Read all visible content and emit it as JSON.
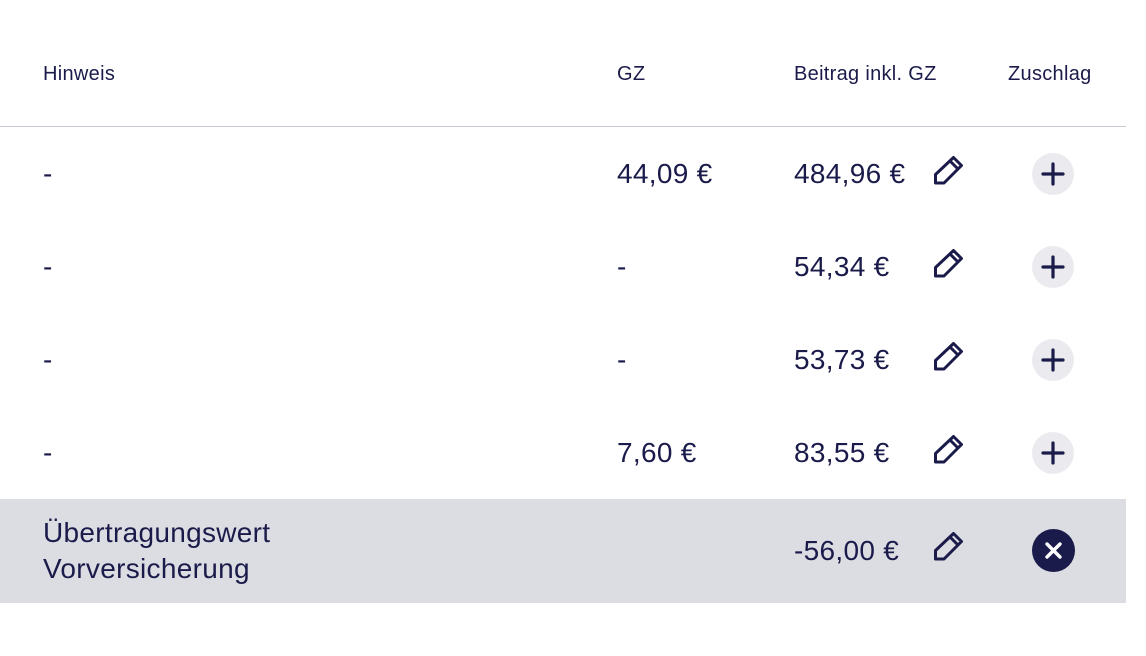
{
  "header": {
    "hinweis": "Hinweis",
    "gz": "GZ",
    "beitrag": "Beitrag inkl. GZ",
    "zuschlag": "Zuschlag"
  },
  "rows": [
    {
      "hinweis": "-",
      "gz": "44,09 €",
      "beitrag": "484,96 €",
      "action": "add"
    },
    {
      "hinweis": "-",
      "gz": "-",
      "beitrag": "54,34 €",
      "action": "add"
    },
    {
      "hinweis": "-",
      "gz": "-",
      "beitrag": "53,73 €",
      "action": "add"
    },
    {
      "hinweis": "-",
      "gz": "7,60 €",
      "beitrag": "83,55 €",
      "action": "add"
    }
  ],
  "highlight_row": {
    "hinweis_line1": "Übertragungswert",
    "hinweis_line2": "Vorversicherung",
    "gz": "",
    "beitrag": "-56,00 €",
    "action": "remove"
  },
  "icons": {
    "edit": "pencil-icon",
    "add": "plus-icon",
    "remove": "close-icon"
  },
  "colors": {
    "text": "#1b1b4b",
    "add_button_bg": "#ebebef",
    "remove_button_bg": "#1b1b4b",
    "highlight_row_bg": "#dcdde2",
    "divider": "#c9c9d1"
  }
}
